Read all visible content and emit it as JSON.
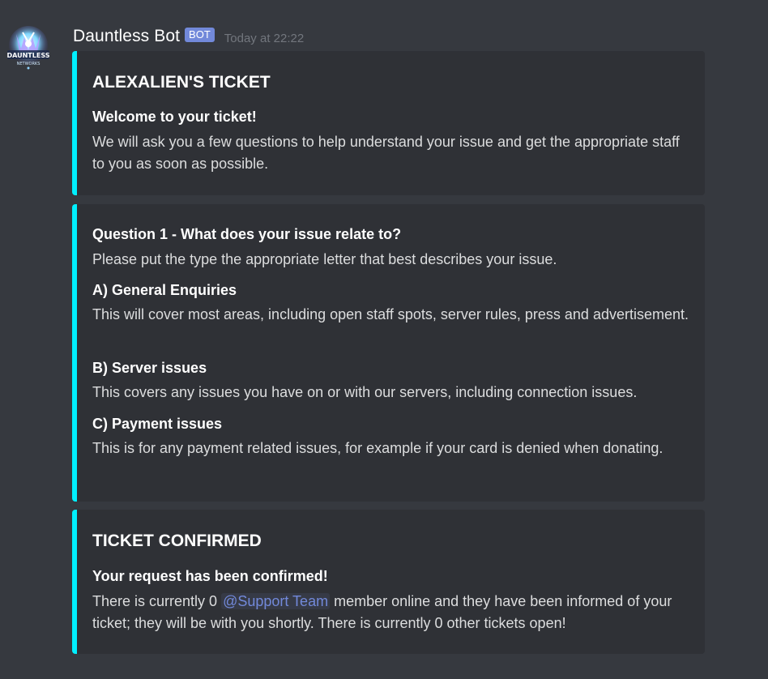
{
  "message": {
    "username": "Dauntless Bot",
    "bot_tag": "BOT",
    "timestamp": "Today at 22:22",
    "avatar_text": "DAUNTLESS",
    "avatar_subtext": "NETWORKS"
  },
  "embeds": [
    {
      "title": "ALEXALIEN'S TICKET",
      "fields": [
        {
          "name": "Welcome to your ticket!",
          "value": "We will ask you a few questions to help understand your issue and get the appropriate staff to you as soon as possible."
        }
      ]
    },
    {
      "fields": [
        {
          "name": "Question 1 - What does your issue relate to?",
          "value": "Please put the type the appropriate letter that best describes your issue."
        },
        {
          "name": "A) General Enquiries",
          "value": "This will cover most areas, including open staff spots, server rules, press and advertisement."
        },
        {
          "name": "B) Server issues",
          "value": "This covers any issues you have on or with our servers, including connection issues."
        },
        {
          "name": "C) Payment issues",
          "value": "This is for any payment related issues, for example if your card is denied when donating."
        }
      ]
    },
    {
      "title": "TICKET CONFIRMED",
      "fields": [
        {
          "name": "Your request has been confirmed!",
          "value_before": "There is currently 0 ",
          "mention": "@Support Team",
          "value_after": " member online and they have been informed of your ticket; they will be with you shortly. There is currently 0 other tickets open!"
        }
      ]
    }
  ],
  "colors": {
    "background": "#36393f",
    "embed_background": "#2f3136",
    "embed_accent": "#00f0ff",
    "bot_tag": "#7289da",
    "mention": "#7289da"
  }
}
